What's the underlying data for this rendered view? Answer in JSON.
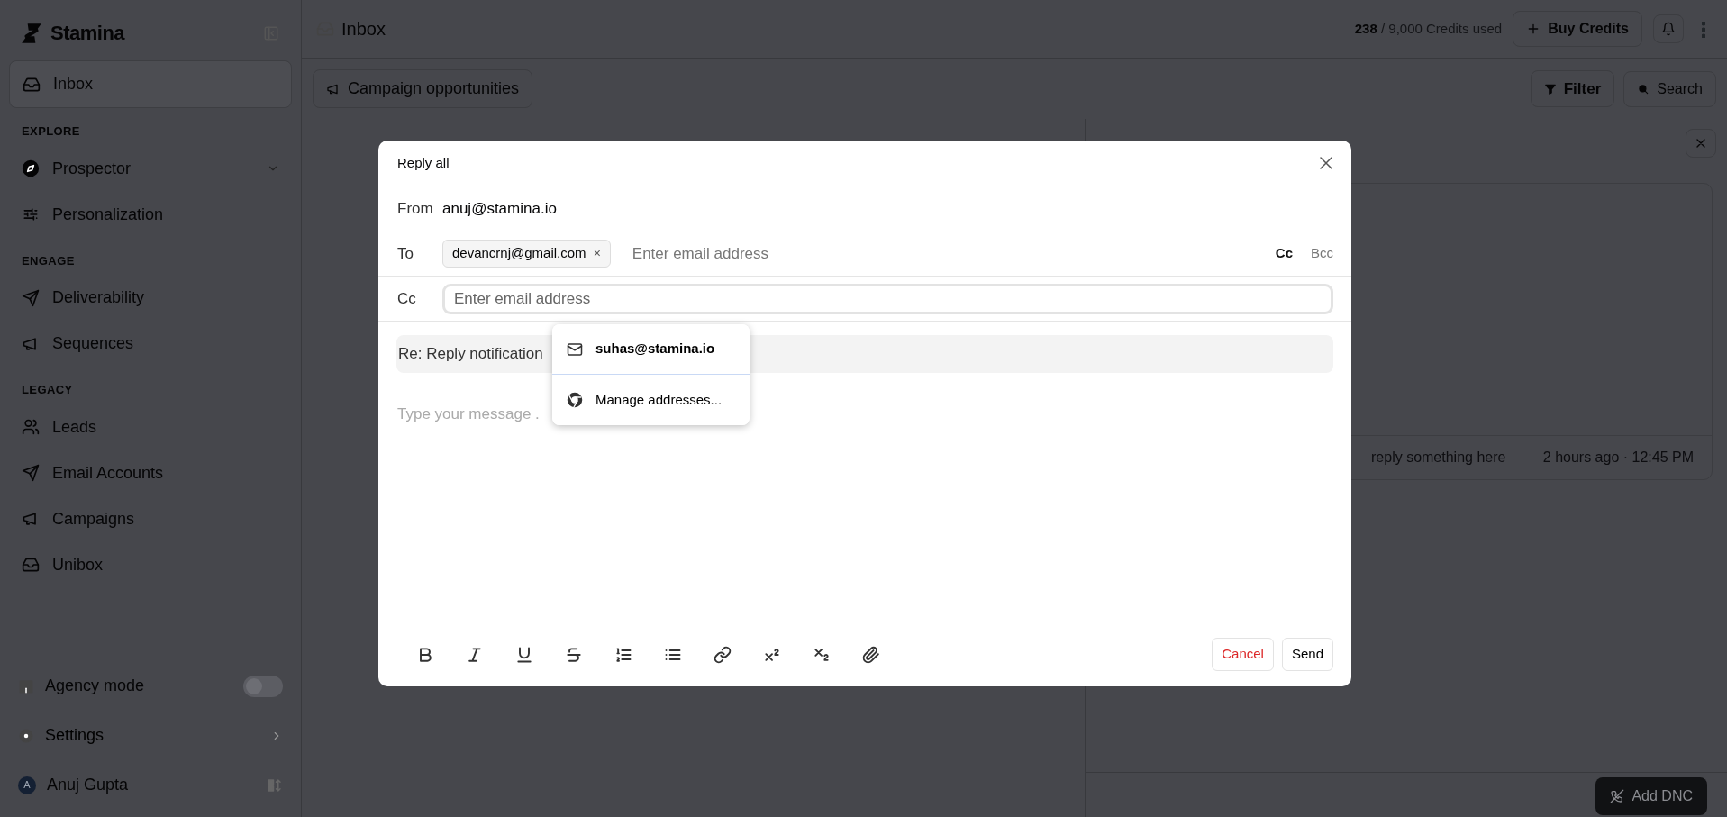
{
  "sidebar": {
    "brand": "Stamina",
    "top_items": [
      {
        "label": "Inbox",
        "selected": true
      }
    ],
    "sections": [
      {
        "title": "EXPLORE",
        "items": [
          {
            "label": "Prospector",
            "selected": false,
            "expandable": true
          },
          {
            "label": "Personalization",
            "selected": false
          }
        ]
      },
      {
        "title": "ENGAGE",
        "items": [
          {
            "label": "Deliverability",
            "selected": false
          },
          {
            "label": "Sequences",
            "selected": false
          }
        ]
      },
      {
        "title": "LEGACY",
        "items": [
          {
            "label": "Leads",
            "selected": false
          },
          {
            "label": "Email Accounts",
            "selected": false
          },
          {
            "label": "Campaigns",
            "selected": false
          },
          {
            "label": "Unibox",
            "selected": false
          }
        ]
      }
    ],
    "footer": [
      {
        "kind": "toggle",
        "label": "Agency mode",
        "on": false
      },
      {
        "kind": "link",
        "label": "Settings"
      },
      {
        "kind": "user",
        "label": "Anuj Gupta",
        "initial": "A"
      }
    ]
  },
  "topbar": {
    "title": "Inbox",
    "credits_used": "238",
    "credits_rest": "/ 9,000 Credits used",
    "buy": "Buy Credits"
  },
  "toolbar": {
    "campaign": "Campaign opportunities",
    "filter": "Filter",
    "search": "Search"
  },
  "reading_pane": {
    "snippet": "reply something here",
    "time": "2 hours ago · 12:45 PM",
    "add_dnc": "Add DNC"
  },
  "modal": {
    "title": "Reply all",
    "from_label": "From",
    "from": "anuj@stamina.io",
    "to_label": "To",
    "recipients": [
      {
        "email": "devancrnj@gmail.com",
        "remove": "×"
      }
    ],
    "to_placeholder": "Enter email address",
    "copy_toggles": [
      {
        "label": "Cc",
        "selected": true
      },
      {
        "label": "Bcc",
        "selected": false
      }
    ],
    "cc_label": "Cc",
    "cc_placeholder": "Enter email address",
    "subject": "Re: Reply notification",
    "body_placeholder": "Type your message .",
    "format_tools": [
      {
        "kind": "bold"
      },
      {
        "kind": "italic"
      },
      {
        "kind": "underline"
      },
      {
        "kind": "strike"
      },
      {
        "kind": "ordered-list"
      },
      {
        "kind": "bullet-list"
      },
      {
        "kind": "link"
      },
      {
        "kind": "superscript"
      },
      {
        "kind": "subscript"
      },
      {
        "kind": "attach"
      }
    ],
    "actions": [
      {
        "kind": "cancel",
        "label": "Cancel"
      },
      {
        "kind": "send",
        "label": "Send"
      }
    ]
  },
  "autocomplete": [
    {
      "kind": "address",
      "label": "suhas@stamina.io"
    },
    {
      "kind": "manage",
      "label": "Manage addresses..."
    }
  ]
}
